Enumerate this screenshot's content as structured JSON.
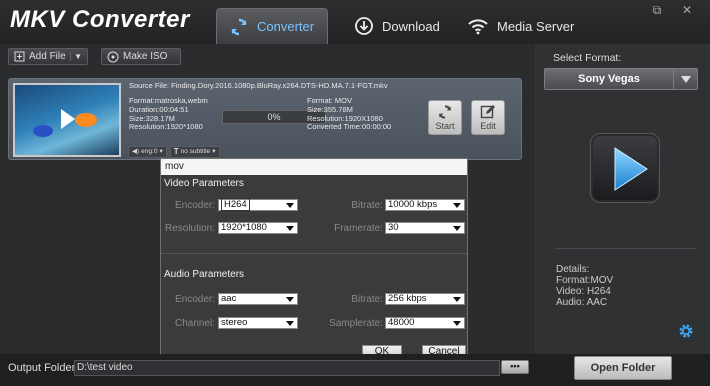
{
  "app": {
    "title": "MKV Converter"
  },
  "tabs": [
    {
      "label": "Converter",
      "icon": "refresh-icon"
    },
    {
      "label": "Download",
      "icon": "download-icon"
    },
    {
      "label": "Media Server",
      "icon": "wifi-icon"
    }
  ],
  "window": {
    "restore_glyph": "⧉",
    "close_glyph": "✕"
  },
  "toolbar": {
    "add_file": "Add File",
    "make_iso": "Make ISO"
  },
  "file": {
    "source": "Source File: Finding.Dory.2016.1080p.BluRay.x264.DTS-HD.MA.7.1-FGT.mkv",
    "src_info": [
      "Format:matroska,webm",
      "Duration:00:04:51",
      "Size:328.17M",
      "Resolution:1920*1080"
    ],
    "dst_info": [
      "Format: MOV",
      "Size:355.78M",
      "Resolution:1920X1080",
      "Converted Time:00:00:00"
    ],
    "progress": "0%",
    "progress_value": 0,
    "start": "Start",
    "edit": "Edit",
    "audio_track": "eng:0",
    "subtitle": "no subtitle"
  },
  "popup": {
    "title": "mov",
    "video_section": "Video Parameters",
    "audio_section": "Audio Parameters",
    "encoder_label": "Encoder:",
    "encoder": "H264",
    "bitrate_label": "Bitrate:",
    "video_bitrate": "10000 kbps",
    "resolution_label": "Resolution:",
    "resolution": "1920*1080",
    "framerate_label": "Framerate:",
    "framerate": "30",
    "audio_encoder_label": "Encoder:",
    "audio_encoder": "aac",
    "audio_bitrate_label": "Bitrate:",
    "audio_bitrate": "256 kbps",
    "channel_label": "Channel:",
    "channel": "stereo",
    "samplerate_label": "Samplerate:",
    "samplerate": "48000",
    "ok": "OK",
    "cancel": "Cancel"
  },
  "right": {
    "select_label": "Select Format:",
    "format": "Sony Vegas",
    "details": [
      "Details:",
      "Format:MOV",
      "Video: H264",
      "Audio: AAC"
    ]
  },
  "bottom": {
    "output_label": "Output Folder:",
    "output_value": "D:\\test video",
    "browse": "•••",
    "open_folder": "Open Folder"
  },
  "colors": {
    "accent": "#7ac4ff",
    "bg": "#262729",
    "logo_blue": "#3aa7f0"
  }
}
